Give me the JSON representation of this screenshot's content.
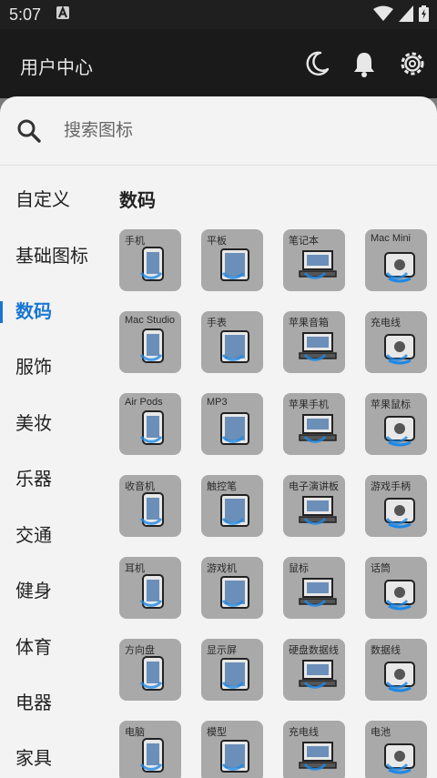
{
  "status_bar": {
    "time": "5:07"
  },
  "app_bar": {
    "title": "用户中心"
  },
  "search": {
    "placeholder": "搜索图标"
  },
  "sidebar": {
    "items": [
      {
        "label": "自定义"
      },
      {
        "label": "基础图标"
      },
      {
        "label": "数码",
        "active": true
      },
      {
        "label": "服饰"
      },
      {
        "label": "美妆"
      },
      {
        "label": "乐器"
      },
      {
        "label": "交通"
      },
      {
        "label": "健身"
      },
      {
        "label": "体育"
      },
      {
        "label": "电器"
      },
      {
        "label": "家具"
      }
    ]
  },
  "section": {
    "title": "数码",
    "icons": [
      {
        "label": "手机",
        "icon": "phone-icon"
      },
      {
        "label": "平板",
        "icon": "tablet-icon"
      },
      {
        "label": "笔记本",
        "icon": "laptop-icon"
      },
      {
        "label": "Mac Mini",
        "icon": "mac-mini-icon"
      },
      {
        "label": "Mac Studio",
        "icon": "mac-studio-icon"
      },
      {
        "label": "手表",
        "icon": "watch-icon"
      },
      {
        "label": "苹果音箱",
        "icon": "apple-speaker-icon"
      },
      {
        "label": "充电线",
        "icon": "charging-cable-icon"
      },
      {
        "label": "Air Pods",
        "icon": "airpods-icon"
      },
      {
        "label": "MP3",
        "icon": "mp3-icon"
      },
      {
        "label": "苹果手机",
        "icon": "iphone-icon"
      },
      {
        "label": "苹果鼠标",
        "icon": "apple-mouse-icon"
      },
      {
        "label": "收音机",
        "icon": "radio-icon"
      },
      {
        "label": "触控笔",
        "icon": "stylus-icon"
      },
      {
        "label": "电子演讲板",
        "icon": "presentation-board-icon"
      },
      {
        "label": "游戏手柄",
        "icon": "gamepad-icon"
      },
      {
        "label": "耳机",
        "icon": "headphones-icon"
      },
      {
        "label": "游戏机",
        "icon": "game-console-icon"
      },
      {
        "label": "鼠标",
        "icon": "mouse-icon"
      },
      {
        "label": "话筒",
        "icon": "microphone-icon"
      },
      {
        "label": "方向盘",
        "icon": "steering-wheel-icon"
      },
      {
        "label": "显示屏",
        "icon": "monitor-icon"
      },
      {
        "label": "硬盘数据线",
        "icon": "hard-drive-cable-icon"
      },
      {
        "label": "数据线",
        "icon": "data-cable-icon"
      },
      {
        "label": "电脑",
        "icon": "computer-icon"
      },
      {
        "label": "模型",
        "icon": "model-icon"
      },
      {
        "label": "充电线",
        "icon": "charging-cable-icon"
      },
      {
        "label": "电池",
        "icon": "battery-icon"
      }
    ]
  },
  "colors": {
    "accent": "#1976d2",
    "tile": "#a9a9a9",
    "sheet": "#f3f3f3",
    "appbar": "#1a1a1a"
  }
}
